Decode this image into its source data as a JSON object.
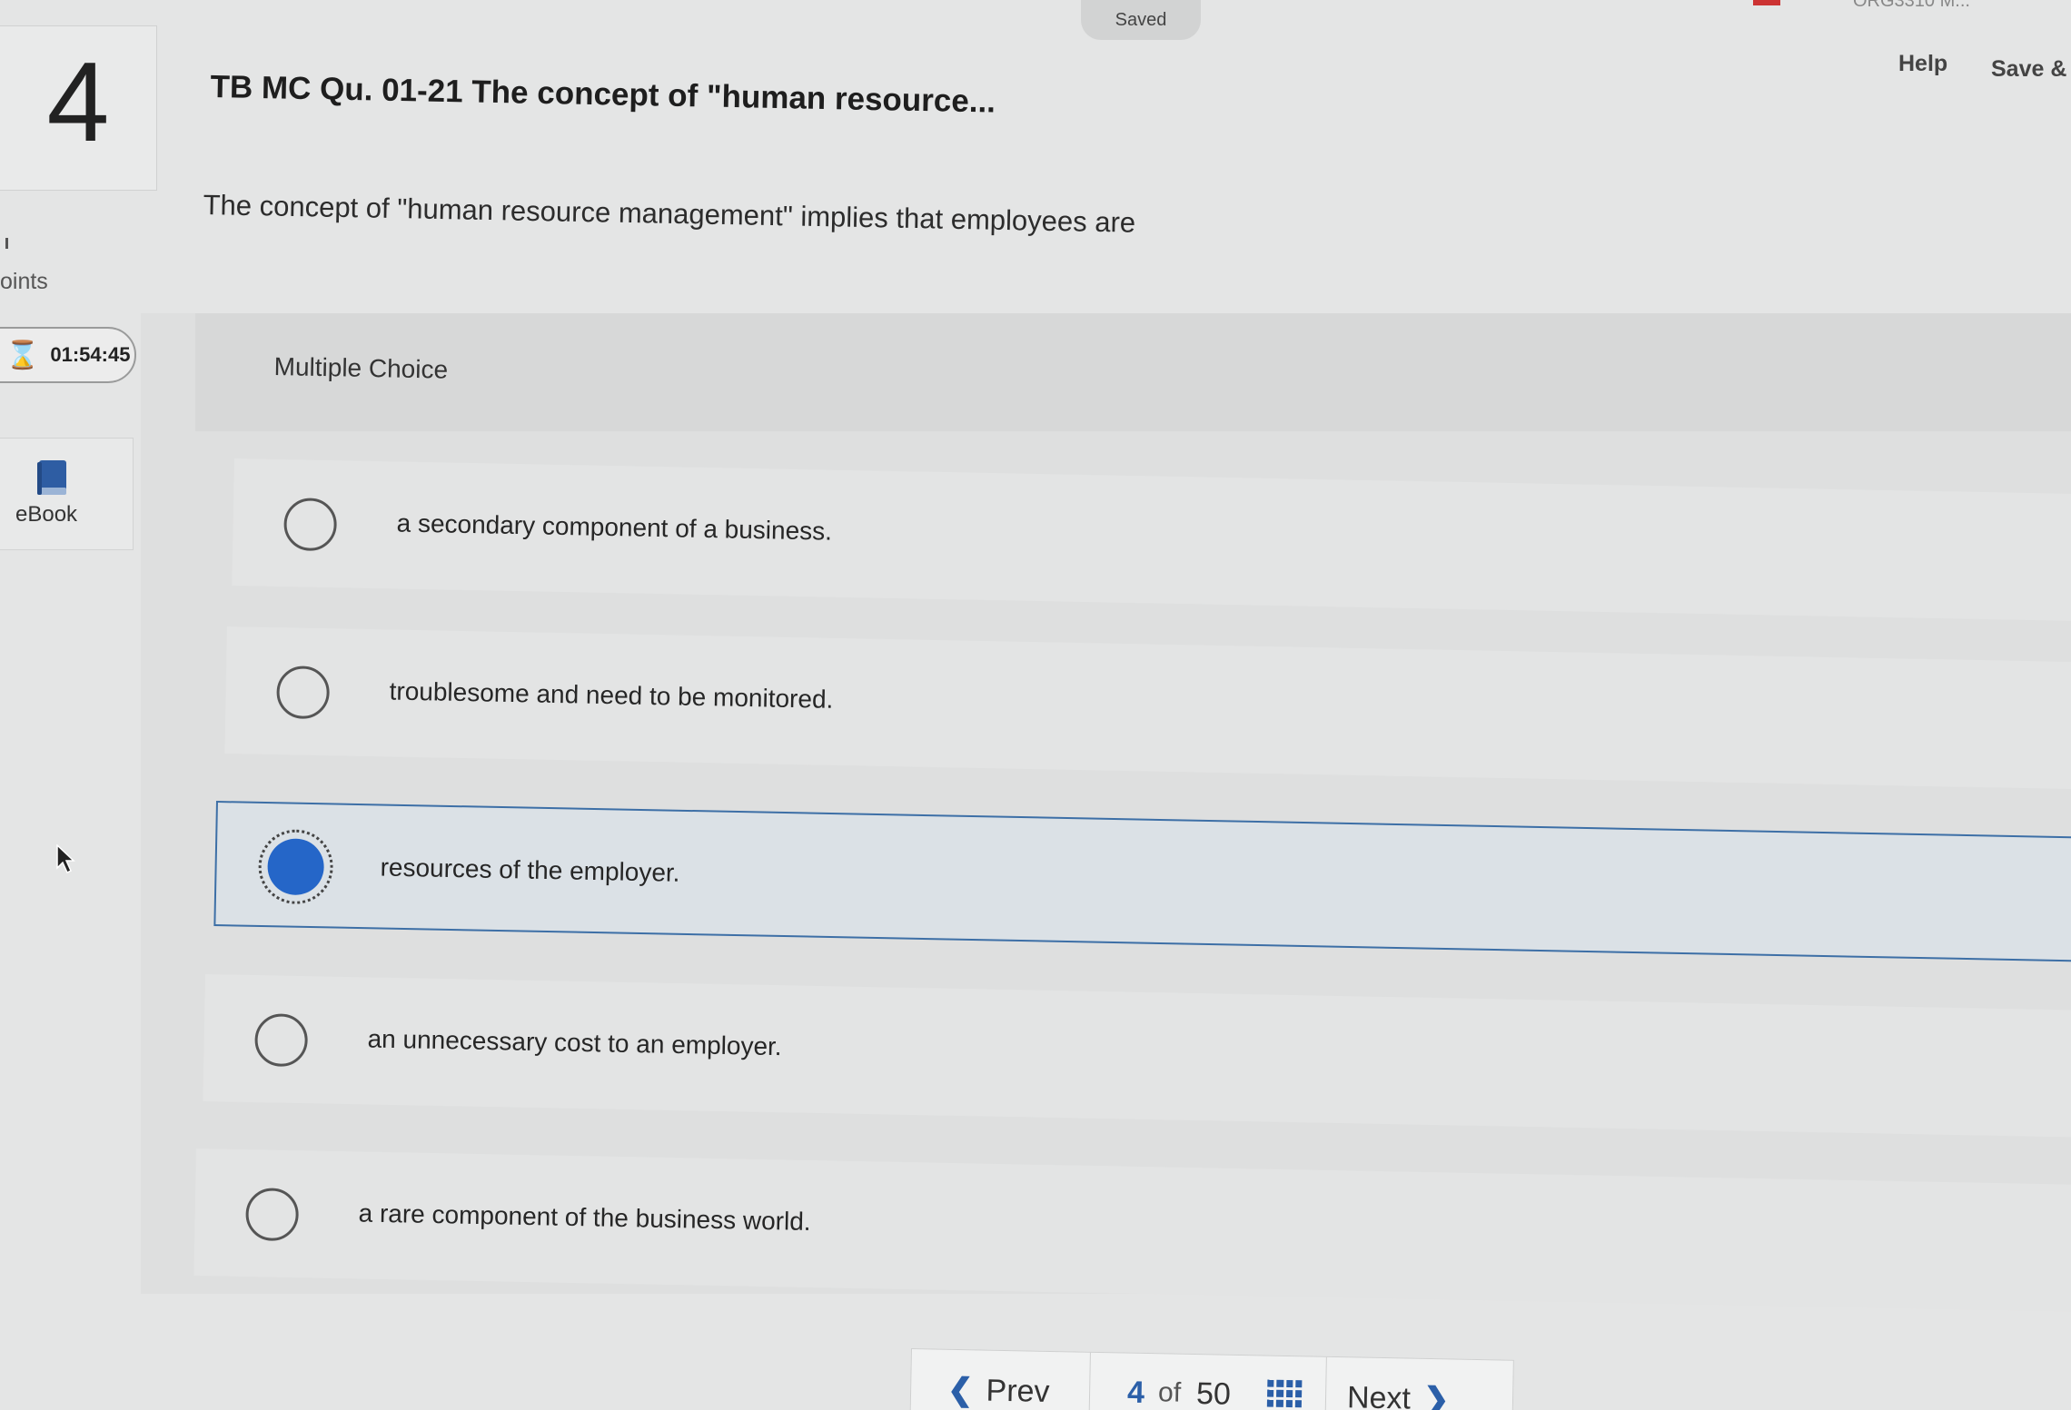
{
  "topbar": {
    "saved": "Saved",
    "course": "ORG3310 M...",
    "help": "Help",
    "save_exit": "Save &"
  },
  "question": {
    "number": "4",
    "points_label": "oints",
    "timer": "01:54:45",
    "ebook": "eBook",
    "title": "TB MC Qu. 01-21 The concept of \"human resource...",
    "prompt": "The concept of \"human resource management\" implies that employees are",
    "type": "Multiple Choice"
  },
  "options": [
    {
      "text": "a secondary component of a business.",
      "selected": false
    },
    {
      "text": "troublesome and need to be monitored.",
      "selected": false
    },
    {
      "text": "resources of the employer.",
      "selected": true
    },
    {
      "text": "an unnecessary cost to an employer.",
      "selected": false
    },
    {
      "text": "a rare component of the business world.",
      "selected": false
    }
  ],
  "nav": {
    "prev": "Prev",
    "current": "4",
    "of": "of",
    "total": "50",
    "next": "Next"
  },
  "colors": {
    "accent": "#2566c8",
    "selected_border": "#3d6fa6",
    "link": "#2b5fa8"
  }
}
